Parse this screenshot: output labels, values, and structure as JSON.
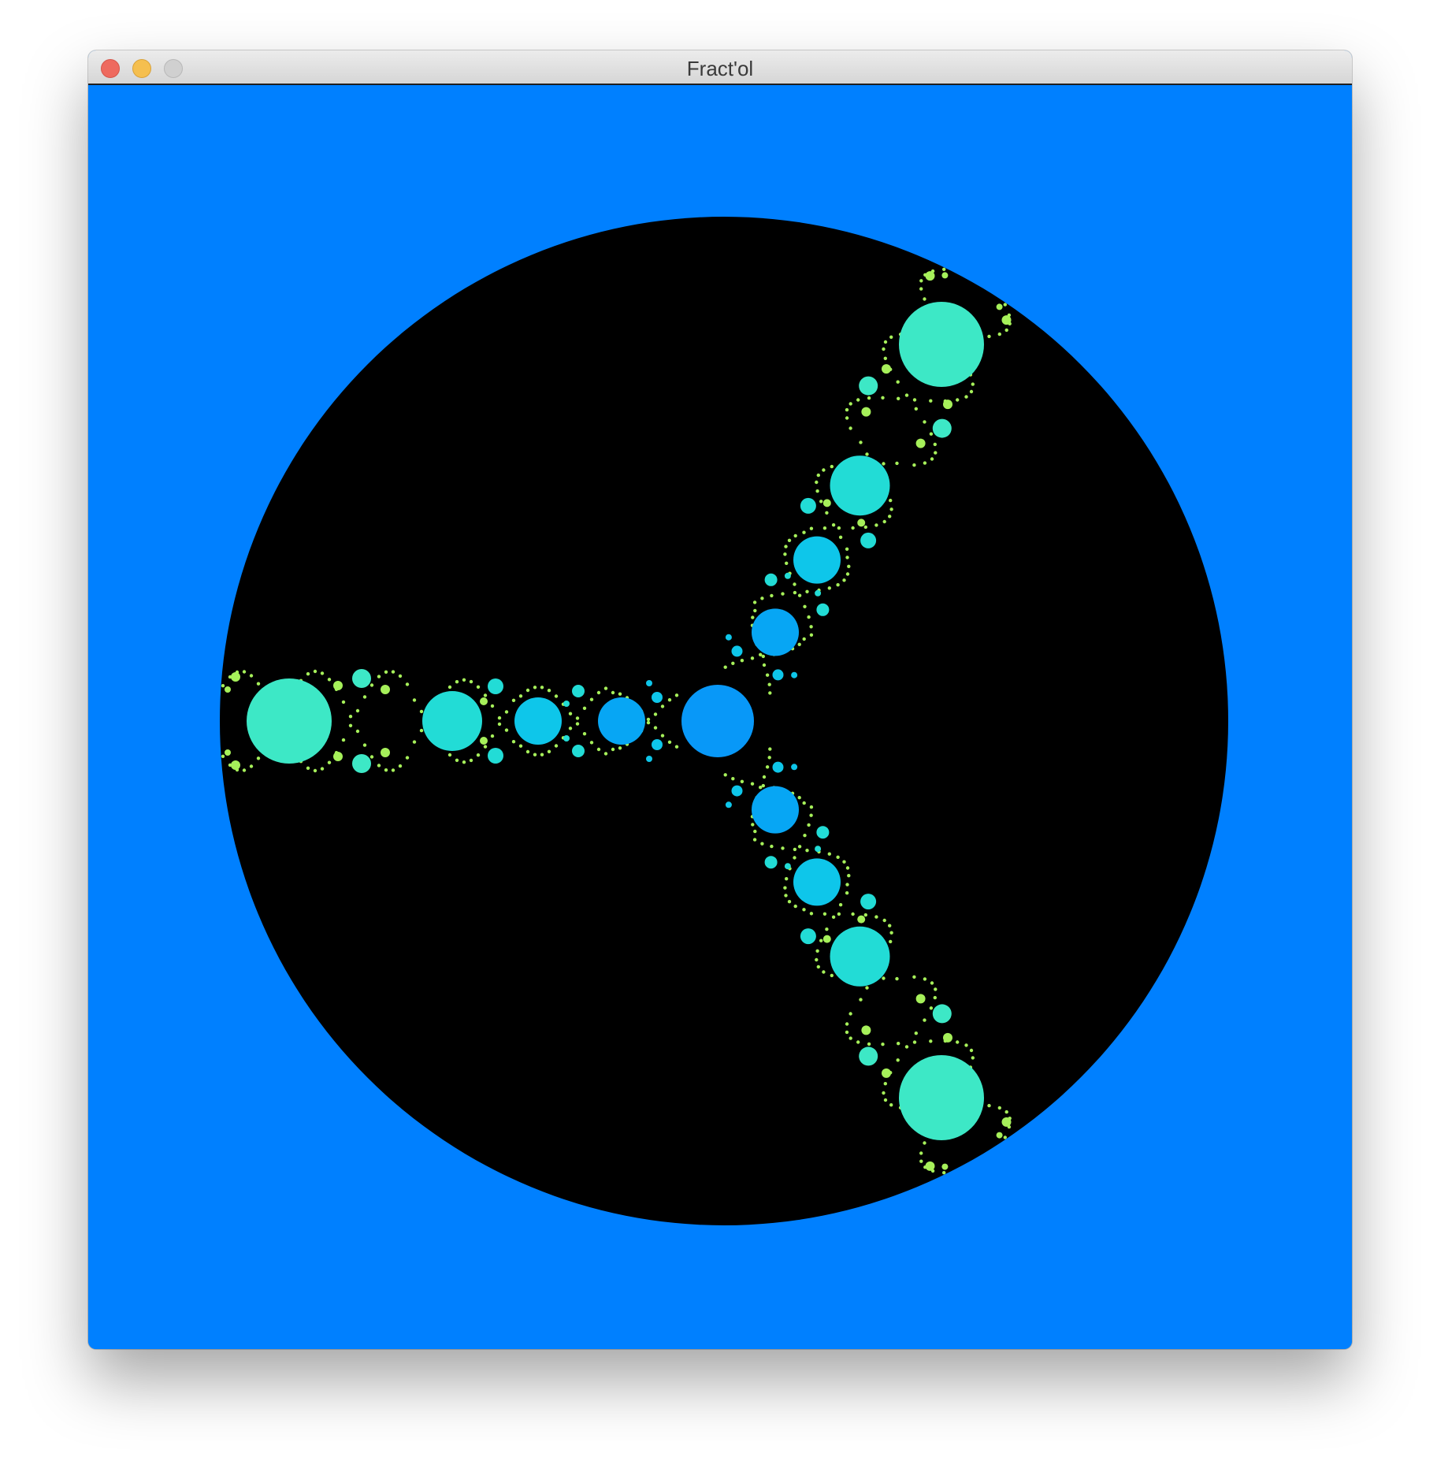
{
  "window": {
    "title": "Fract'ol",
    "controls": [
      "close-button",
      "minimize-button",
      "zoom-button"
    ]
  },
  "fractal": {
    "type": "julia",
    "colors": {
      "background": "#0080ff",
      "set": "#000000",
      "bulb_outer": "#3de8c6",
      "bulb_mid": "#22dcd6",
      "bulb_inner": "#0ec6ea",
      "bulb_core": "#07a6f4",
      "center": "#0898f8",
      "filament": "#a6f05a"
    }
  }
}
